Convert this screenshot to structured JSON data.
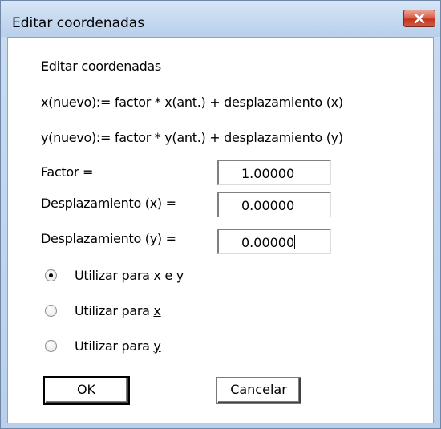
{
  "window": {
    "title": "Editar coordenadas"
  },
  "dialog": {
    "heading": "Editar coordenadas",
    "formula_x": "x(nuevo):= factor * x(ant.) + desplazamiento (x)",
    "formula_y": "y(nuevo):= factor * y(ant.) + desplazamiento (y)",
    "fields": [
      {
        "label": "Factor =",
        "value": "1.00000"
      },
      {
        "label": "Desplazamiento (x) =",
        "value": "0.00000"
      },
      {
        "label": "Desplazamiento (y) =",
        "value": "0.00000"
      }
    ],
    "options": [
      {
        "label_pre": "Utilizar para x ",
        "mnemonic": "e",
        "label_post": " y",
        "selected": true
      },
      {
        "label_pre": "Utilizar para ",
        "mnemonic": "x",
        "label_post": "",
        "selected": false
      },
      {
        "label_pre": "Utilizar para ",
        "mnemonic": "y",
        "label_post": "",
        "selected": false
      }
    ],
    "buttons": {
      "ok_mnemonic": "O",
      "ok_rest": "K",
      "cancel_pre": "Cance",
      "cancel_mnemonic": "l",
      "cancel_post": "ar"
    }
  }
}
